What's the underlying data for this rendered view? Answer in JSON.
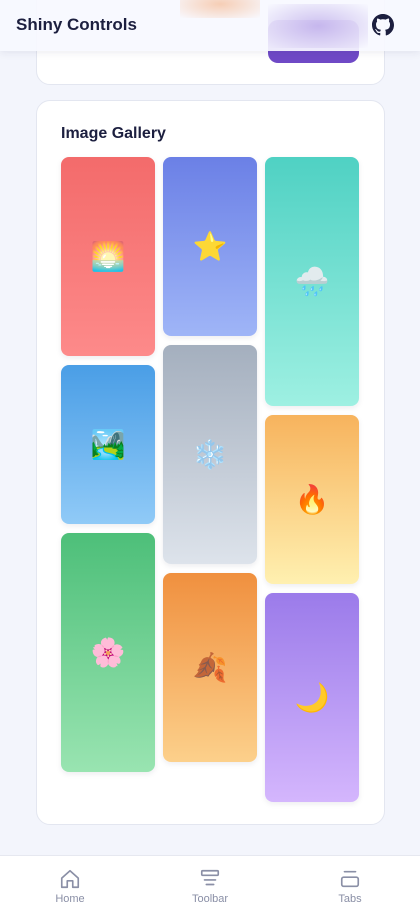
{
  "header": {
    "title": "Shiny Controls",
    "github_icon": "github-icon"
  },
  "gallery": {
    "title": "Image Gallery",
    "tiles": [
      {
        "emoji": "🌅",
        "icon": "sunset-icon",
        "color_top": "#f36b6b",
        "color_bottom": "#fd8a8a"
      },
      {
        "emoji": "🏞️",
        "icon": "mountain-lake-icon",
        "color_top": "#4a9ee6",
        "color_bottom": "#90caf7"
      },
      {
        "emoji": "🌸",
        "icon": "cherry-blossom-icon",
        "color_top": "#4dbf79",
        "color_bottom": "#99e4b1"
      },
      {
        "emoji": "⭐",
        "icon": "star-icon",
        "color_top": "#6b80e6",
        "color_bottom": "#9fb5f7"
      },
      {
        "emoji": "❄️",
        "icon": "snowflake-icon",
        "color_top": "#a4afbe",
        "color_bottom": "#dde3eb"
      },
      {
        "emoji": "🍂",
        "icon": "fallen-leaf-icon",
        "color_top": "#f0903f",
        "color_bottom": "#fcd08b"
      },
      {
        "emoji": "🌧️",
        "icon": "rain-cloud-icon",
        "color_top": "#4fd1c3",
        "color_bottom": "#9ef0e2"
      },
      {
        "emoji": "🔥",
        "icon": "fire-icon",
        "color_top": "#f7b35d",
        "color_bottom": "#fff0b0"
      },
      {
        "emoji": "🌙",
        "icon": "moon-icon",
        "color_top": "#9b7bea",
        "color_bottom": "#d4b6fd"
      }
    ]
  },
  "nav": [
    {
      "label": "Home",
      "icon": "home-icon"
    },
    {
      "label": "Toolbar",
      "icon": "toolbar-icon"
    },
    {
      "label": "Tabs",
      "icon": "tabs-icon"
    }
  ]
}
